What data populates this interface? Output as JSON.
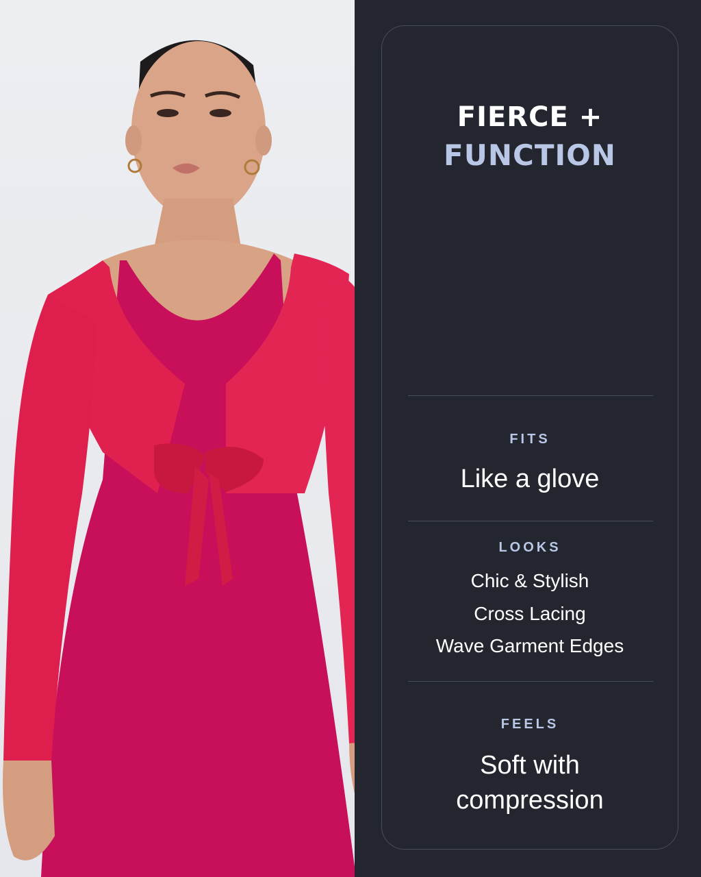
{
  "headline": {
    "line1": "FIERCE +",
    "line2": "FUNCTION"
  },
  "features": [
    {
      "label": "FITS",
      "values": [
        "Like a glove"
      ]
    },
    {
      "label": "LOOKS",
      "values": [
        "Chic & Stylish",
        "Cross Lacing",
        "Wave Garment Edges"
      ]
    },
    {
      "label": "FEELS",
      "values": [
        "Soft with",
        "compression"
      ]
    }
  ],
  "colors": {
    "panel_background": "#23252f",
    "headline_primary": "#ffffff",
    "headline_accent": "#b9c7e6",
    "label_color": "#b9c7e6",
    "garment_pink": "#e0214f",
    "jumpsuit_magenta": "#c8105a"
  }
}
